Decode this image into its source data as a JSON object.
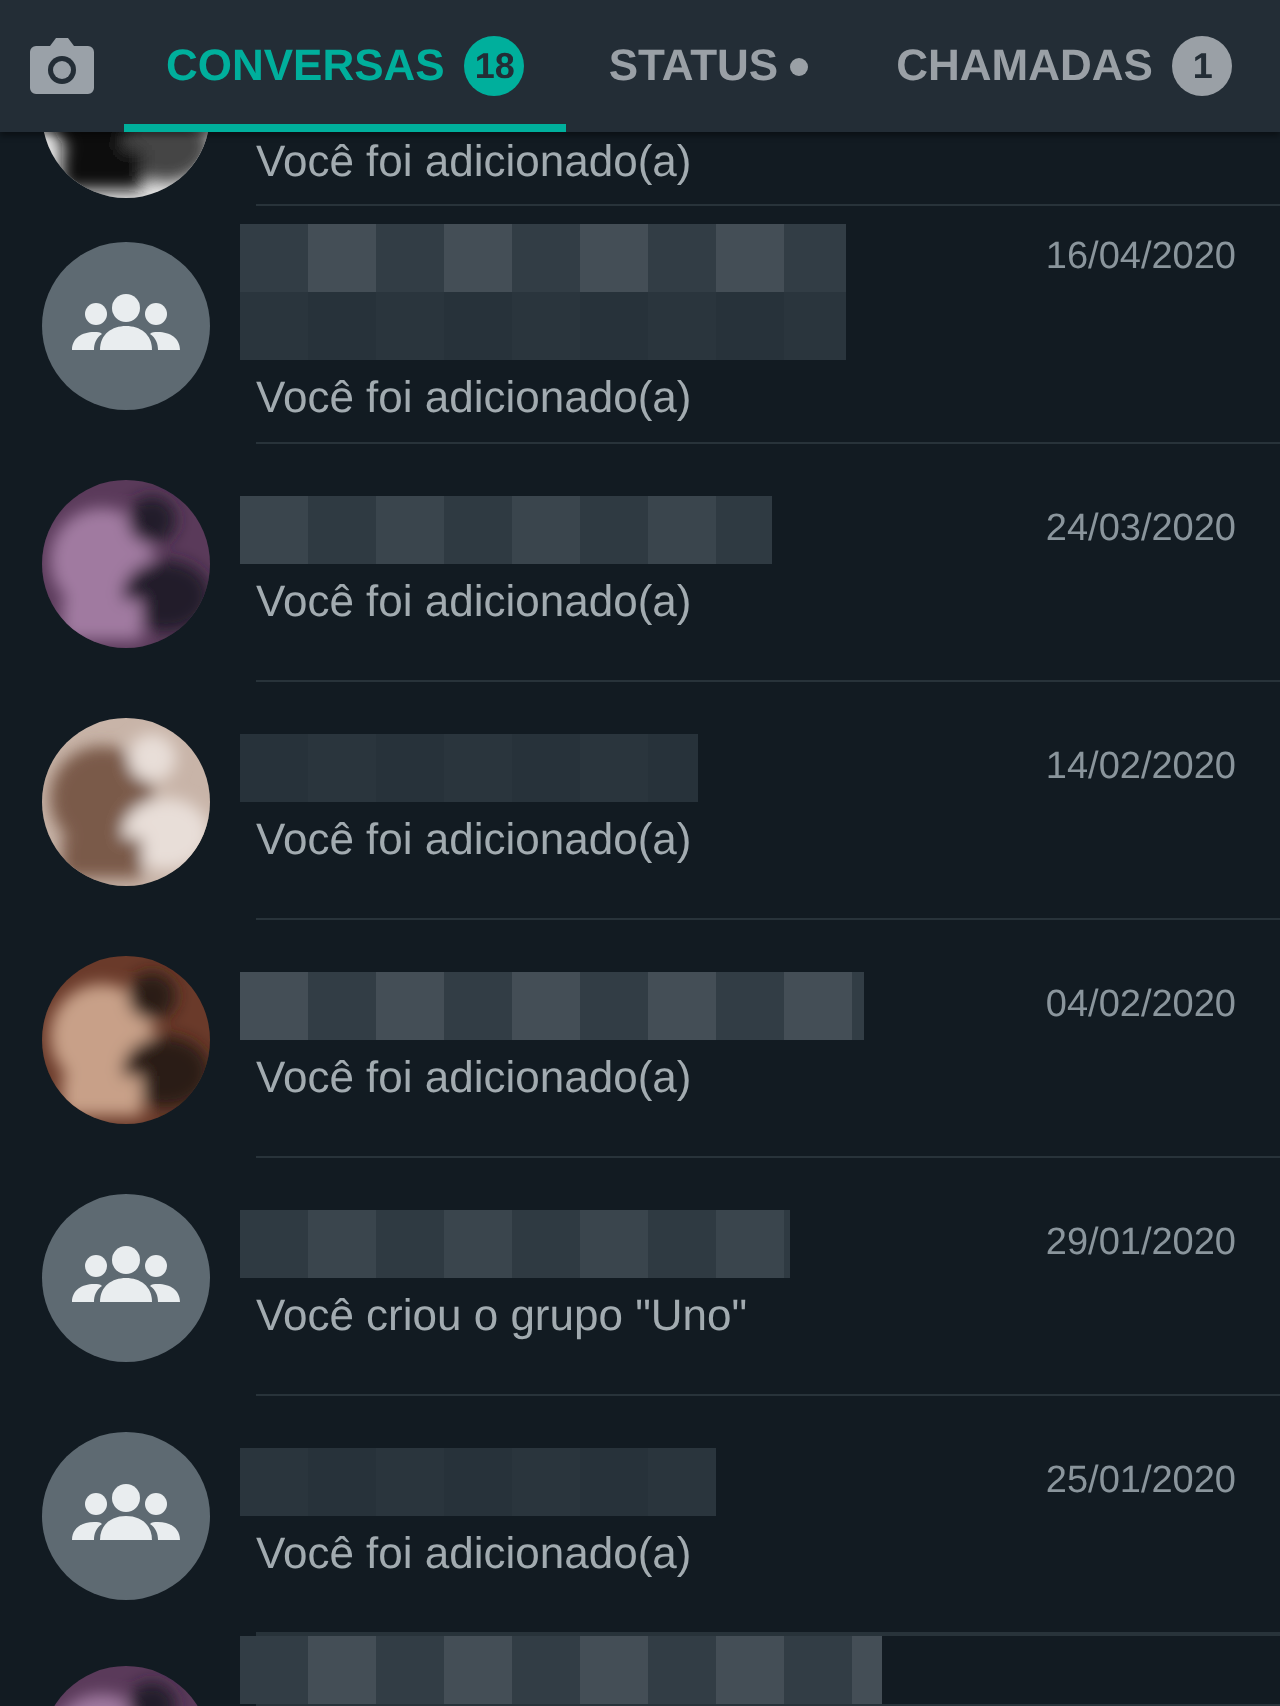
{
  "tabs": [
    {
      "label": "CONVERSAS",
      "selected": true,
      "kind": "count",
      "badge": "18"
    },
    {
      "label": "STATUS",
      "selected": false,
      "kind": "dot"
    },
    {
      "label": "CHAMADAS",
      "selected": false,
      "kind": "count",
      "badge": "1"
    }
  ],
  "chats": [
    {
      "kind": "picture",
      "preview": "Você foi adicionado(a)"
    },
    {
      "kind": "group",
      "date": "16/04/2020",
      "preview": "Você foi adicionado(a)"
    },
    {
      "kind": "picture",
      "date": "24/03/2020",
      "preview": "Você foi adicionado(a)"
    },
    {
      "kind": "picture",
      "date": "14/02/2020",
      "preview": "Você foi adicionado(a)"
    },
    {
      "kind": "picture",
      "date": "04/02/2020",
      "preview": "Você foi adicionado(a)"
    },
    {
      "kind": "group",
      "date": "29/01/2020",
      "preview": "Você criou o grupo \"Uno\""
    },
    {
      "kind": "group",
      "date": "25/01/2020",
      "preview": "Você foi adicionado(a)"
    },
    {
      "kind": "picture"
    }
  ]
}
